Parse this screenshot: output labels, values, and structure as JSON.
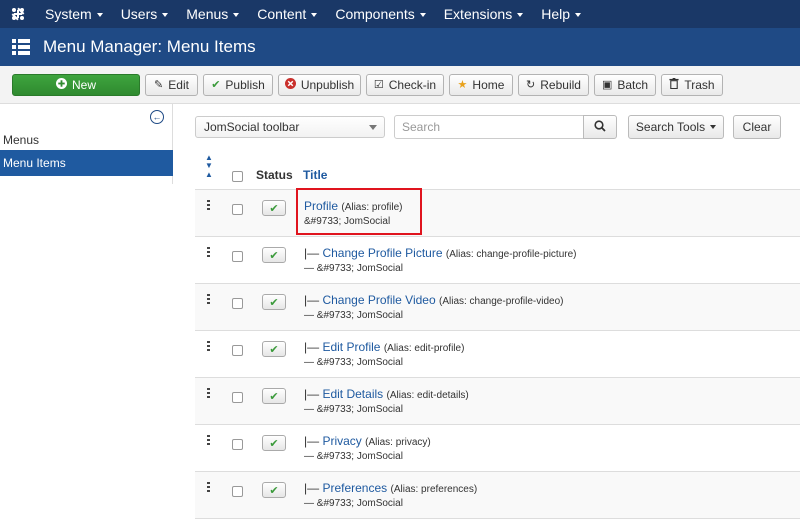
{
  "topnav": {
    "items": [
      {
        "label": "System"
      },
      {
        "label": "Users"
      },
      {
        "label": "Menus"
      },
      {
        "label": "Content"
      },
      {
        "label": "Components"
      },
      {
        "label": "Extensions"
      },
      {
        "label": "Help"
      }
    ]
  },
  "titlebar": {
    "title": "Menu Manager: Menu Items"
  },
  "toolbar": {
    "new": "New",
    "edit": "Edit",
    "publish": "Publish",
    "unpublish": "Unpublish",
    "checkin": "Check-in",
    "home": "Home",
    "rebuild": "Rebuild",
    "batch": "Batch",
    "trash": "Trash"
  },
  "sidebar": {
    "section": "Menus",
    "active_item": "Menu Items"
  },
  "filters": {
    "menu_select": "JomSocial toolbar",
    "search_placeholder": "Search",
    "search_tools": "Search Tools",
    "clear": "Clear"
  },
  "table": {
    "headers": {
      "status": "Status",
      "title": "Title"
    },
    "rows": [
      {
        "prefix": "",
        "title": "Profile",
        "alias": "(Alias: profile)",
        "meta": "&#9733; JomSocial"
      },
      {
        "prefix": "|— ",
        "title": "Change Profile Picture",
        "alias": "(Alias: change-profile-picture)",
        "meta": "— &#9733; JomSocial"
      },
      {
        "prefix": "|— ",
        "title": "Change Profile Video",
        "alias": "(Alias: change-profile-video)",
        "meta": "— &#9733; JomSocial"
      },
      {
        "prefix": "|— ",
        "title": "Edit Profile",
        "alias": "(Alias: edit-profile)",
        "meta": "— &#9733; JomSocial"
      },
      {
        "prefix": "|— ",
        "title": "Edit Details",
        "alias": "(Alias: edit-details)",
        "meta": "— &#9733; JomSocial"
      },
      {
        "prefix": "|— ",
        "title": "Privacy",
        "alias": "(Alias: privacy)",
        "meta": "— &#9733; JomSocial"
      },
      {
        "prefix": "|— ",
        "title": "Preferences",
        "alias": "(Alias: preferences)",
        "meta": "— &#9733; JomSocial"
      }
    ]
  },
  "colors": {
    "nav_bg": "#1a3867",
    "title_bg": "#1f4a85",
    "accent": "#1f5aa0",
    "new_button": "#3ea43e",
    "highlight": "#e0141e"
  }
}
